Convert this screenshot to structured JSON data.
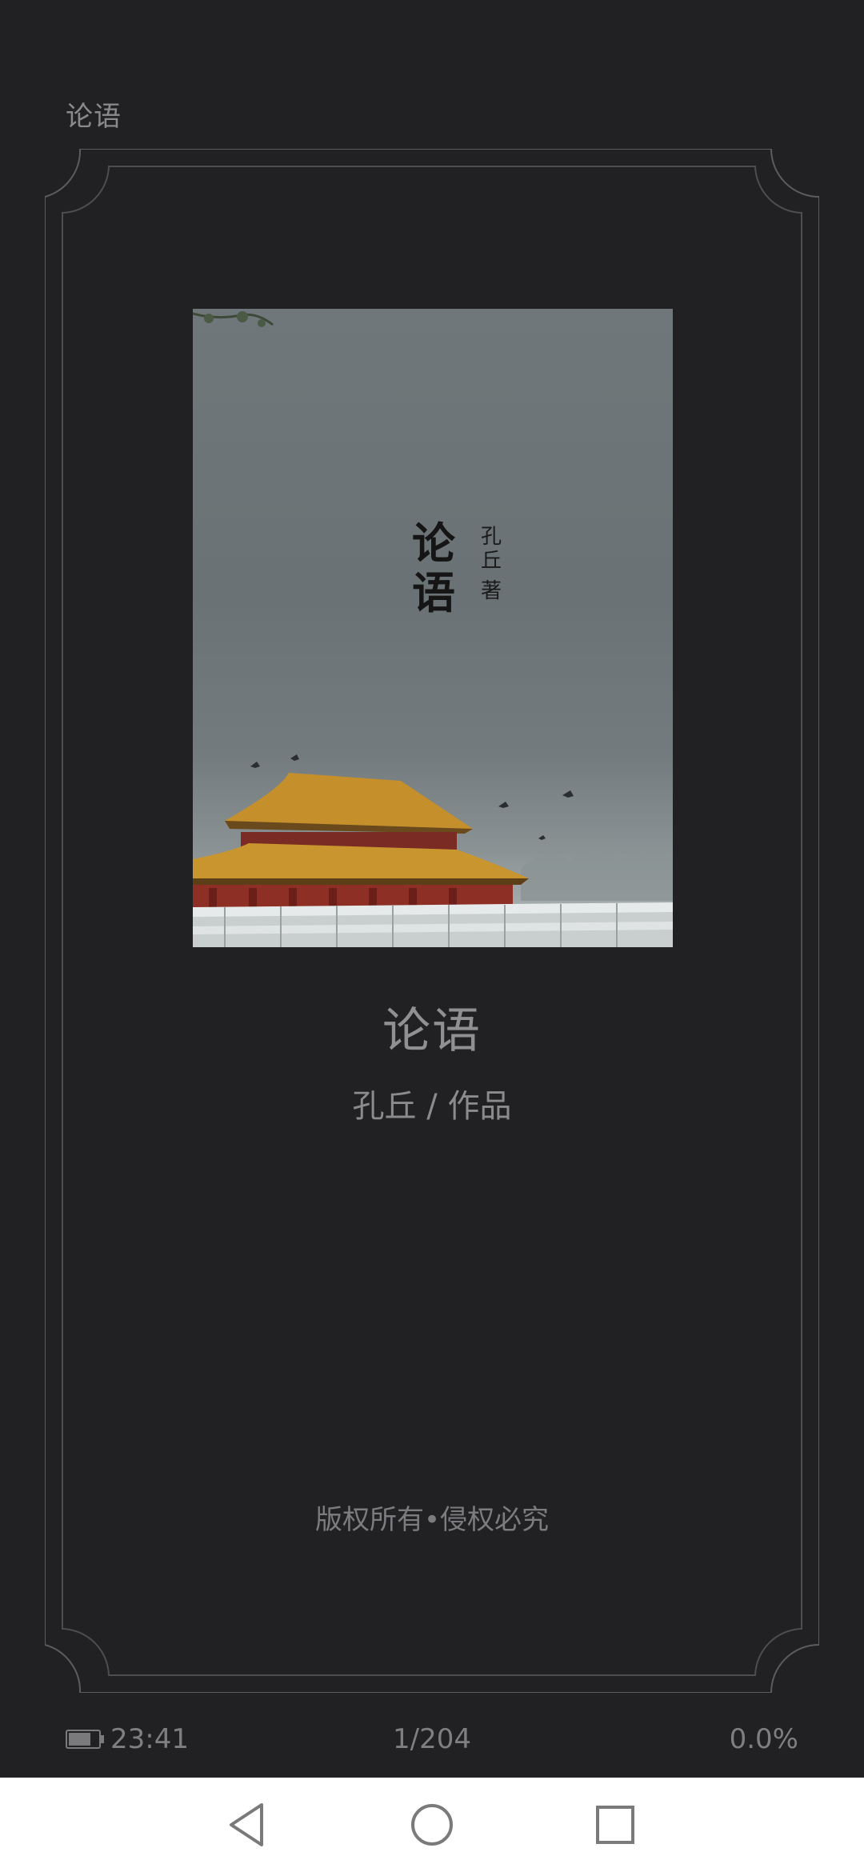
{
  "header": {
    "title": "论语"
  },
  "cover": {
    "title": "论语",
    "author": "孔丘",
    "author_mark": "著"
  },
  "book": {
    "title": "论语",
    "author_line": "孔丘 / 作品"
  },
  "footer": {
    "copyright": "版权所有•侵权必究"
  },
  "status": {
    "time": "23:41",
    "page": "1/204",
    "progress": "0.0%",
    "battery_level": 0.75
  },
  "colors": {
    "background": "#212124",
    "frame": "#6a6a6d",
    "text_muted": "#8a8a8d",
    "nav_background": "#ffffff"
  },
  "nav": {
    "back_icon": "triangle-back-icon",
    "home_icon": "circle-home-icon",
    "recents_icon": "square-recents-icon"
  }
}
